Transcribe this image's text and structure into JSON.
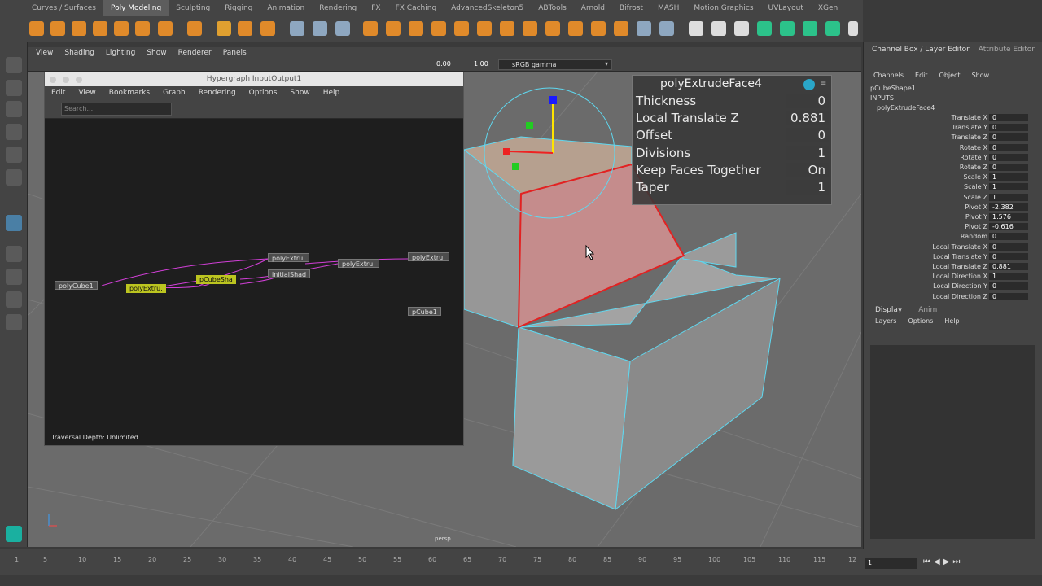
{
  "shelf_tabs": [
    "Curves / Surfaces",
    "Poly Modeling",
    "Sculpting",
    "Rigging",
    "Animation",
    "Rendering",
    "FX",
    "FX Caching",
    "AdvancedSkeleton5",
    "ABTools",
    "Arnold",
    "Bifrost",
    "MASH",
    "Motion Graphics",
    "UVLayout",
    "XGen"
  ],
  "panel_menu": [
    "View",
    "Shading",
    "Lighting",
    "Show",
    "Renderer",
    "Panels"
  ],
  "panel_toolbar": {
    "val1": "0.00",
    "val2": "1.00",
    "color_space": "sRGB gamma"
  },
  "hypergraph": {
    "title": "Hypergraph InputOutput1",
    "menu": [
      "Edit",
      "View",
      "Bookmarks",
      "Graph",
      "Rendering",
      "Options",
      "Show",
      "Help"
    ],
    "search_placeholder": "Search...",
    "nodes": {
      "polyCube1": "polyCube1",
      "polyExtrude_a": "polyExtru.",
      "polyExtrude_b": "polyExtru.",
      "polyExtrude_c": "polyExtru.",
      "polyExtrude_d": "polyExtru.",
      "pCubeShape": "pCubeSha",
      "initialShading": "initialShad",
      "pCube1": "pCube1"
    },
    "status": "Traversal Depth: Unlimited"
  },
  "hud": {
    "title": "polyExtrudeFace4",
    "rows": [
      {
        "label": "Thickness",
        "value": "0"
      },
      {
        "label": "Local Translate Z",
        "value": "0.881"
      },
      {
        "label": "Offset",
        "value": "0"
      },
      {
        "label": "Divisions",
        "value": "1"
      },
      {
        "label": "Keep Faces Together",
        "value": "On"
      },
      {
        "label": "Taper",
        "value": "1"
      }
    ]
  },
  "viewport": {
    "camera": "persp"
  },
  "channel_box": {
    "tab_main": "Channel Box / Layer Editor",
    "tab_attr": "Attribute Editor",
    "menu": [
      "Channels",
      "Edit",
      "Object",
      "Show"
    ],
    "object": "pCubeShape1",
    "inputs_label": "INPUTS",
    "input_node": "polyExtrudeFace4",
    "attrs": [
      {
        "name": "Translate X",
        "value": "0"
      },
      {
        "name": "Translate Y",
        "value": "0"
      },
      {
        "name": "Translate Z",
        "value": "0"
      },
      {
        "name": "Rotate X",
        "value": "0"
      },
      {
        "name": "Rotate Y",
        "value": "0"
      },
      {
        "name": "Rotate Z",
        "value": "0"
      },
      {
        "name": "Scale X",
        "value": "1"
      },
      {
        "name": "Scale Y",
        "value": "1"
      },
      {
        "name": "Scale Z",
        "value": "1"
      },
      {
        "name": "Pivot X",
        "value": "-2.382"
      },
      {
        "name": "Pivot Y",
        "value": "1.576"
      },
      {
        "name": "Pivot Z",
        "value": "-0.616"
      },
      {
        "name": "Random",
        "value": "0"
      },
      {
        "name": "Local Translate X",
        "value": "0"
      },
      {
        "name": "Local Translate Y",
        "value": "0"
      },
      {
        "name": "Local Translate Z",
        "value": "0.881"
      },
      {
        "name": "Local Direction X",
        "value": "1"
      },
      {
        "name": "Local Direction Y",
        "value": "0"
      },
      {
        "name": "Local Direction Z",
        "value": "0"
      }
    ]
  },
  "layer_editor": {
    "tabs": [
      "Display",
      "Anim"
    ],
    "menu": [
      "Layers",
      "Options",
      "Help"
    ]
  },
  "timeline": {
    "ticks": [
      "1",
      "5",
      "10",
      "15",
      "20",
      "25",
      "30",
      "35",
      "40",
      "45",
      "50",
      "55",
      "60",
      "65",
      "70",
      "75",
      "80",
      "85",
      "90",
      "95",
      "100",
      "105",
      "110",
      "115",
      "12"
    ],
    "current_frame": "1"
  }
}
